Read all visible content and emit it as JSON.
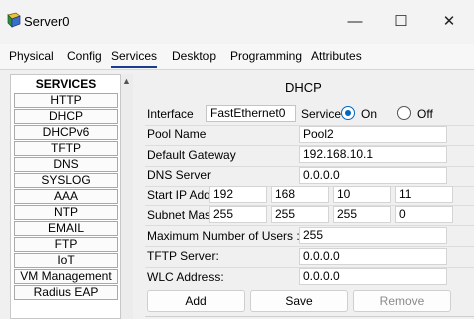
{
  "window": {
    "title": "Server0",
    "icon": "server-app-icon",
    "controls": {
      "minimize": "—",
      "maximize": "☐",
      "close": "✕"
    }
  },
  "tabs": [
    "Physical",
    "Config",
    "Services",
    "Desktop",
    "Programming",
    "Attributes"
  ],
  "active_tab": "Services",
  "services": {
    "header": "SERVICES",
    "items": [
      "HTTP",
      "DHCP",
      "DHCPv6",
      "TFTP",
      "DNS",
      "SYSLOG",
      "AAA",
      "NTP",
      "EMAIL",
      "FTP",
      "IoT",
      "VM Management",
      "Radius EAP"
    ]
  },
  "dhcp": {
    "title": "DHCP",
    "interface_label": "Interface",
    "interface_value": "FastEthernet0",
    "service_label": "Service",
    "on_label": "On",
    "off_label": "Off",
    "service_state": "On",
    "pool_name_label": "Pool Name",
    "pool_name": "Pool2",
    "gateway_label": "Default Gateway",
    "gateway": "192.168.10.1",
    "dns_label": "DNS Server",
    "dns": "0.0.0.0",
    "start_ip_label": "Start IP Addr",
    "start_ip": [
      "192",
      "168",
      "10",
      "11"
    ],
    "subnet_label": "Subnet Mask",
    "subnet": [
      "255",
      "255",
      "255",
      "0"
    ],
    "max_users_label": "Maximum Number of Users :",
    "max_users": "255",
    "tftp_label": "TFTP Server:",
    "tftp": "0.0.0.0",
    "wlc_label": "WLC Address:",
    "wlc": "0.0.0.0",
    "buttons": {
      "add": "Add",
      "save": "Save",
      "remove": "Remove"
    }
  }
}
